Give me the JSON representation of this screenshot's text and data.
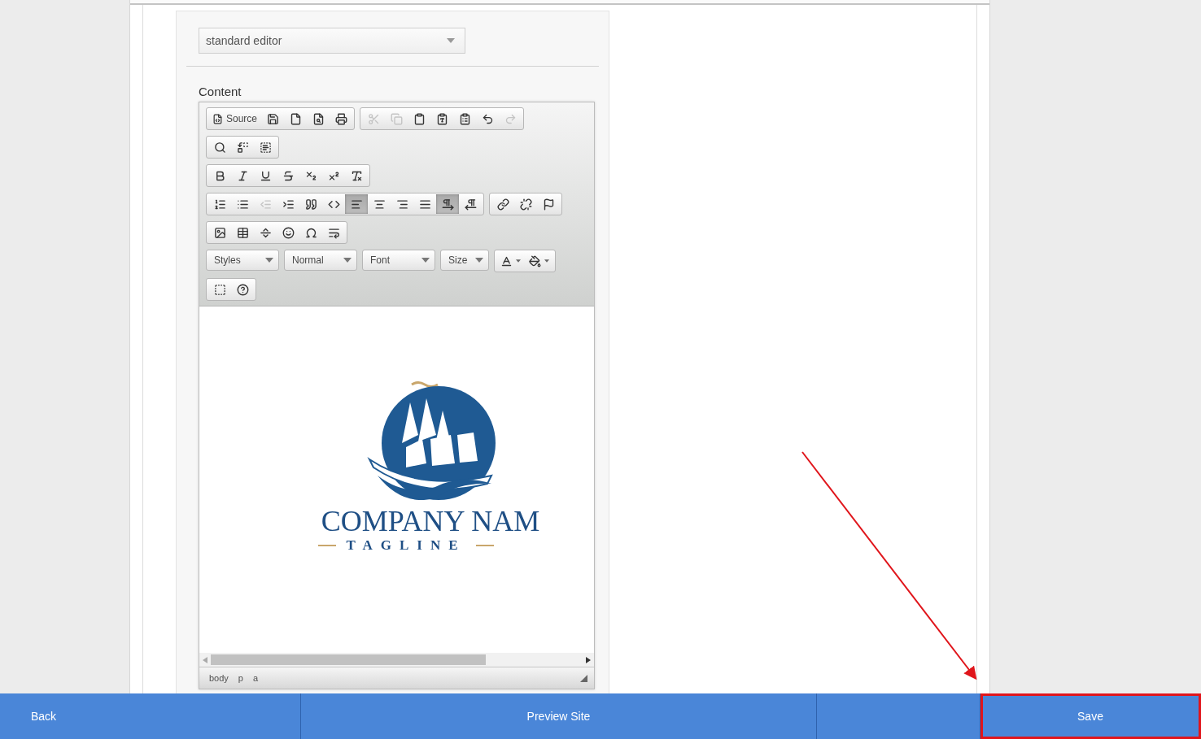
{
  "header_type_select": {
    "value": "standard editor"
  },
  "content_label": "Content",
  "toolbar": {
    "rows": [
      [
        {
          "items": [
            {
              "label": "Source",
              "disabled": false,
              "on": false
            },
            {
              "disabled": false,
              "on": false
            },
            {
              "disabled": false,
              "on": false
            },
            {
              "disabled": false,
              "on": false
            },
            {
              "disabled": false,
              "on": false
            }
          ]
        },
        {
          "items": [
            {
              "disabled": true,
              "on": false
            },
            {
              "disabled": true,
              "on": false
            },
            {
              "disabled": false,
              "on": false
            },
            {
              "disabled": false,
              "on": false
            },
            {
              "disabled": false,
              "on": false
            },
            {
              "disabled": false,
              "on": false
            },
            {
              "disabled": true,
              "on": false
            }
          ]
        }
      ],
      [
        {
          "items": [
            {
              "disabled": false,
              "on": false
            },
            {
              "disabled": false,
              "on": false
            },
            {
              "disabled": false,
              "on": false
            }
          ]
        }
      ],
      [
        {
          "items": [
            {
              "disabled": false,
              "on": false
            },
            {
              "disabled": false,
              "on": false
            },
            {
              "disabled": false,
              "on": false
            },
            {
              "disabled": false,
              "on": false
            },
            {
              "disabled": false,
              "on": false
            },
            {
              "disabled": false,
              "on": false
            },
            {
              "disabled": false,
              "on": false
            }
          ]
        }
      ],
      [
        {
          "items": [
            {
              "disabled": false,
              "on": false
            },
            {
              "disabled": false,
              "on": false
            },
            {
              "disabled": true,
              "on": false
            },
            {
              "disabled": false,
              "on": false
            },
            {
              "disabled": false,
              "on": false
            },
            {
              "disabled": false,
              "on": false
            },
            {
              "disabled": false,
              "on": true
            },
            {
              "disabled": false,
              "on": false
            },
            {
              "disabled": false,
              "on": false
            },
            {
              "disabled": false,
              "on": false
            },
            {
              "disabled": false,
              "on": true
            },
            {
              "disabled": false,
              "on": false
            }
          ]
        },
        {
          "items": [
            {
              "disabled": false,
              "on": false
            },
            {
              "disabled": false,
              "on": false
            },
            {
              "disabled": false,
              "on": false
            }
          ]
        }
      ],
      [
        {
          "items": [
            {
              "disabled": false,
              "on": false
            },
            {
              "disabled": false,
              "on": false
            },
            {
              "disabled": false,
              "on": false
            },
            {
              "disabled": false,
              "on": false
            },
            {
              "disabled": false,
              "on": false
            },
            {
              "disabled": false,
              "on": false
            }
          ]
        }
      ],
      [
        {
          "kind": "combo",
          "label": "Styles"
        },
        {
          "kind": "combo",
          "label": "Normal"
        },
        {
          "kind": "combo",
          "label": "Font"
        },
        {
          "kind": "combo",
          "label": "Size"
        },
        {
          "items": [
            {
              "disabled": false,
              "on": false
            },
            {
              "disabled": false,
              "on": false
            }
          ]
        }
      ],
      [
        {
          "items": [
            {
              "disabled": false,
              "on": false
            },
            {
              "disabled": false,
              "on": false
            }
          ]
        }
      ]
    ]
  },
  "logo": {
    "name": "COMPANY NAM",
    "tagline": "TAGLINE"
  },
  "path": [
    "body",
    "p",
    "a"
  ],
  "footer_buttons": [
    {
      "label": "Back",
      "highlighted": false
    },
    {
      "label": "Preview Site",
      "highlighted": false
    },
    {
      "highlighted": false
    },
    {
      "label": "Save",
      "highlighted": true
    }
  ],
  "annotation_arrow": true
}
